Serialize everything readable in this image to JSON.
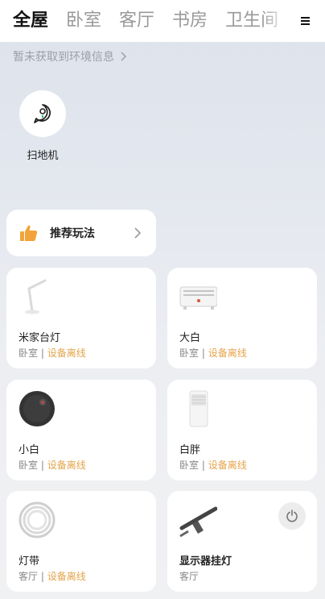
{
  "tabs": {
    "items": [
      {
        "label": "全屋",
        "active": true
      },
      {
        "label": "卧室",
        "active": false
      },
      {
        "label": "客厅",
        "active": false
      },
      {
        "label": "书房",
        "active": false
      },
      {
        "label": "卫生间",
        "active": false
      }
    ],
    "menu_icon": "menu-icon"
  },
  "env": {
    "text": "暂未获取到环境信息",
    "icon": "chevron-right-icon"
  },
  "shortcut": {
    "label": "扫地机",
    "icon": "robot-assistant-icon"
  },
  "recommend": {
    "label": "推荐玩法",
    "icon": "thumbs-up-icon",
    "accent": "#f2a33a"
  },
  "devices": [
    {
      "name": "米家台灯",
      "room": "卧室",
      "status": "设备离线",
      "icon": "desk-lamp-icon"
    },
    {
      "name": "大白",
      "room": "卧室",
      "status": "设备离线",
      "icon": "heater-icon"
    },
    {
      "name": "小白",
      "room": "卧室",
      "status": "设备离线",
      "icon": "robot-vacuum-icon"
    },
    {
      "name": "白胖",
      "room": "卧室",
      "status": "设备离线",
      "icon": "air-purifier-icon"
    },
    {
      "name": "灯带",
      "room": "客厅",
      "status": "设备离线",
      "icon": "light-strip-icon"
    },
    {
      "name": "显示器挂灯",
      "room": "客厅",
      "status": "",
      "icon": "monitor-light-icon",
      "power_icon": "power-icon"
    }
  ],
  "colors": {
    "offline": "#e4a44a",
    "muted": "#888888"
  }
}
